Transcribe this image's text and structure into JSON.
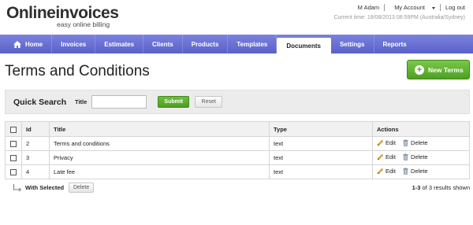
{
  "brand": {
    "logo_part1": "Online",
    "logo_part2": "invoices",
    "tagline": "easy online billing",
    "accent_color": "#5ab332"
  },
  "top_links": {
    "user": "M Adam",
    "account": "My Account",
    "logout": "Log out",
    "current_time": "Current time: 19/08/2013 08:59PM (Australia/Sydney)"
  },
  "nav": {
    "color": "#6a70d6",
    "items": [
      {
        "label": "Home",
        "icon": "home-icon"
      },
      {
        "label": "Invoices"
      },
      {
        "label": "Estimates"
      },
      {
        "label": "Clients"
      },
      {
        "label": "Products"
      },
      {
        "label": "Templates"
      },
      {
        "label": "Documents",
        "active": true
      },
      {
        "label": "Settings"
      },
      {
        "label": "Reports"
      }
    ]
  },
  "page": {
    "title": "Terms and Conditions",
    "new_button": "New Terms"
  },
  "search": {
    "heading": "Quick Search",
    "title_label": "Title",
    "title_value": "",
    "submit": "Submit",
    "reset": "Reset"
  },
  "table": {
    "headers": {
      "id": "Id",
      "title": "Title",
      "type": "Type",
      "actions": "Actions"
    },
    "rows": [
      {
        "id": "2",
        "title": "Terms and conditions",
        "type": "text"
      },
      {
        "id": "3",
        "title": "Privacy",
        "type": "text"
      },
      {
        "id": "4",
        "title": "Late fee",
        "type": "text"
      }
    ],
    "edit_label": "Edit",
    "delete_label": "Delete"
  },
  "bulk": {
    "label": "With Selected",
    "delete_button": "Delete"
  },
  "results": {
    "range": "1-3",
    "text": " of 3 results shown"
  }
}
